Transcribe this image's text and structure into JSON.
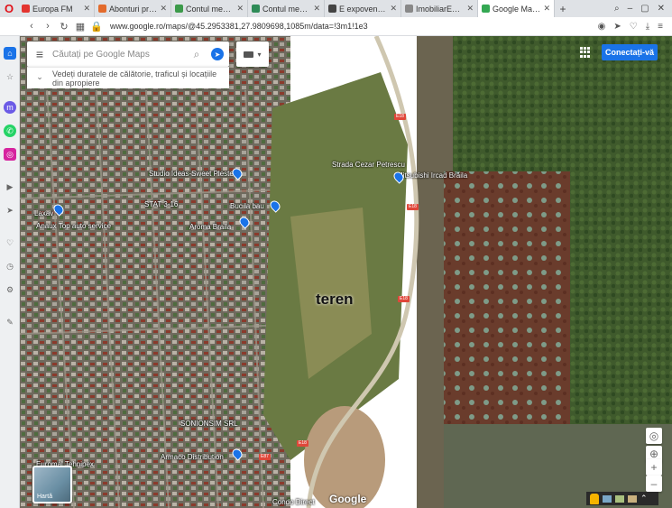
{
  "browser": {
    "brand_letter": "O",
    "tabs": [
      {
        "title": "Europa FM",
        "color": "#e3342f"
      },
      {
        "title": "Abonturi promo",
        "color": "#e36b2c"
      },
      {
        "title": "Contul meu › An",
        "color": "#3c9a4a"
      },
      {
        "title": "Contul meu › Mi",
        "color": "#2e8b57"
      },
      {
        "title": "E expoventul si t",
        "color": "#444444"
      },
      {
        "title": "ImobiliarEagent",
        "color": "#888888"
      },
      {
        "title": "Google Maps",
        "color": "#34a853",
        "active": true
      }
    ],
    "url": "www.google.ro/maps/@45.2953381,27.9809698,1085m/data=!3m1!1e3"
  },
  "maps": {
    "search_placeholder": "Căutați pe Google Maps",
    "explore_text": "Vedeți duratele de călătorie, traficul și locațiile din apropiere",
    "signin_label": "Conectați-vă",
    "google_logo": "Google",
    "thumbnail_label": "Hartă",
    "annotation": "teren",
    "places": {
      "mitsubishi": "Mitsubishi Ircad Brăila",
      "street_top": "Strada Cezar Petrescu",
      "laxav": "Laxav",
      "autoservice": "Anaux Top auto service",
      "studio": "Studio Ideas-Sweet Pleste",
      "stat": "STAT 3-16",
      "aroma": "Aroma Braila",
      "bau": "Buc la bau",
      "sion": "SONIONSIM SRL",
      "armaco": "Armaco Distribution",
      "eurometal": "Euromal Tehnipex",
      "condo": "Condo Direct"
    },
    "road_shields": [
      "E18",
      "E18",
      "E18",
      "E18",
      "E87"
    ]
  }
}
